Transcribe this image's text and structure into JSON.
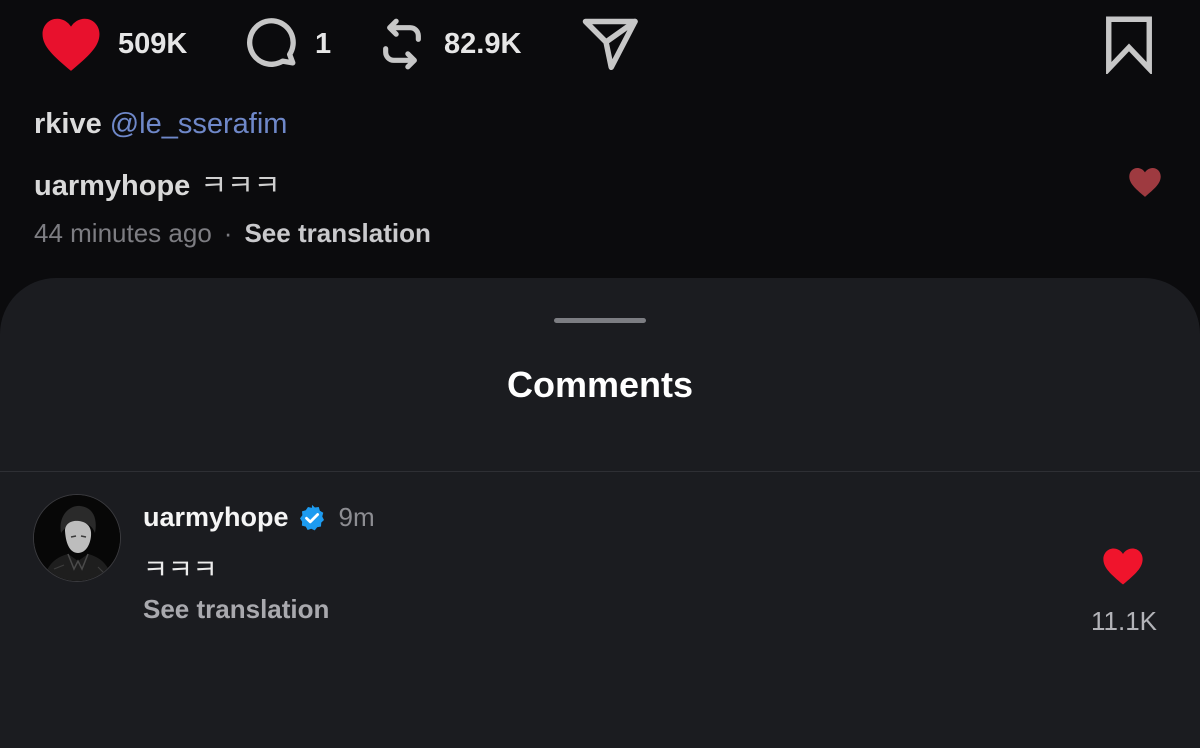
{
  "post_actions": {
    "likes": "509K",
    "comments": "1",
    "reposts": "82.9K",
    "icons": [
      "heart-filled-icon",
      "comment-bubble-icon",
      "repost-icon",
      "send-icon",
      "bookmark-icon"
    ]
  },
  "caption": {
    "author": "rkive",
    "mention": "@le_sserafim"
  },
  "preview_comment": {
    "author": "uarmyhope",
    "text": "ㅋㅋㅋ",
    "time_ago": "44 minutes ago",
    "separator": "·",
    "translate_label": "See translation",
    "like_icon": "heart-small-icon"
  },
  "sheet": {
    "title": "Comments"
  },
  "comment": {
    "author": "uarmyhope",
    "verified": true,
    "time": "9m",
    "text": "ㅋㅋㅋ",
    "translate_label": "See translation",
    "likes": "11.1K"
  },
  "colors": {
    "like_red": "#e8112d",
    "mention_blue": "#6f88c9",
    "verified_blue": "#1d9bf0",
    "sheet_bg": "#1b1c20",
    "page_bg": "#0b0b0d"
  }
}
